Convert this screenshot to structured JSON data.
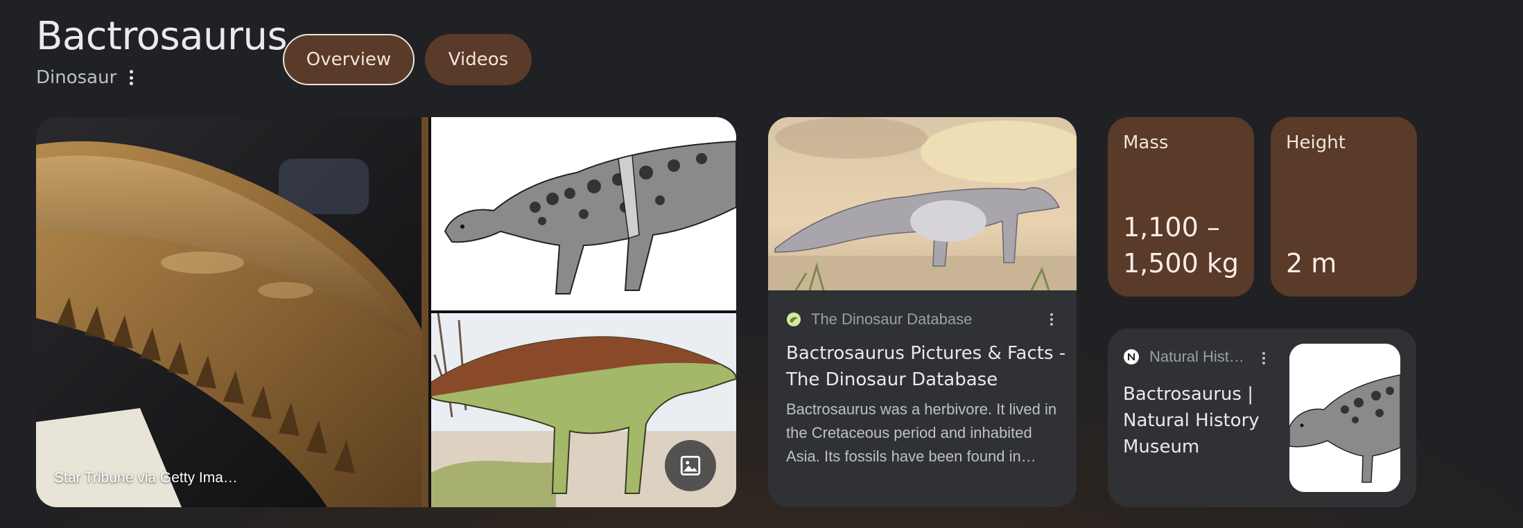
{
  "header": {
    "title": "Bactrosaurus",
    "subtitle": "Dinosaur",
    "tabs": [
      {
        "label": "Overview",
        "selected": true
      },
      {
        "label": "Videos",
        "selected": false
      }
    ]
  },
  "gallery": {
    "main_credit": "Star Tribune via Getty Ima…",
    "image_button_icon": "image-icon"
  },
  "result_db": {
    "source": "The Dinosaur Database",
    "title_line1": "Bactrosaurus Pictures & Facts -",
    "title_line2": "The Dinosaur Database",
    "snippet": "Bactrosaurus was a herbivore. It lived in the Cretaceous period and inhabited Asia. Its fossils have been found in…"
  },
  "facts": [
    {
      "label": "Mass",
      "value_line1": "1,100 –",
      "value_line2": "1,500 kg"
    },
    {
      "label": "Height",
      "value_line1": "",
      "value_line2": "2 m"
    }
  ],
  "result_nhm": {
    "source": "Natural Hist…",
    "title_line1": "Bactrosaurus |",
    "title_line2": "Natural History",
    "title_line3": "Museum"
  },
  "colors": {
    "background": "#202124",
    "accent_brown": "#5a3a28",
    "card_bg": "#303134"
  }
}
